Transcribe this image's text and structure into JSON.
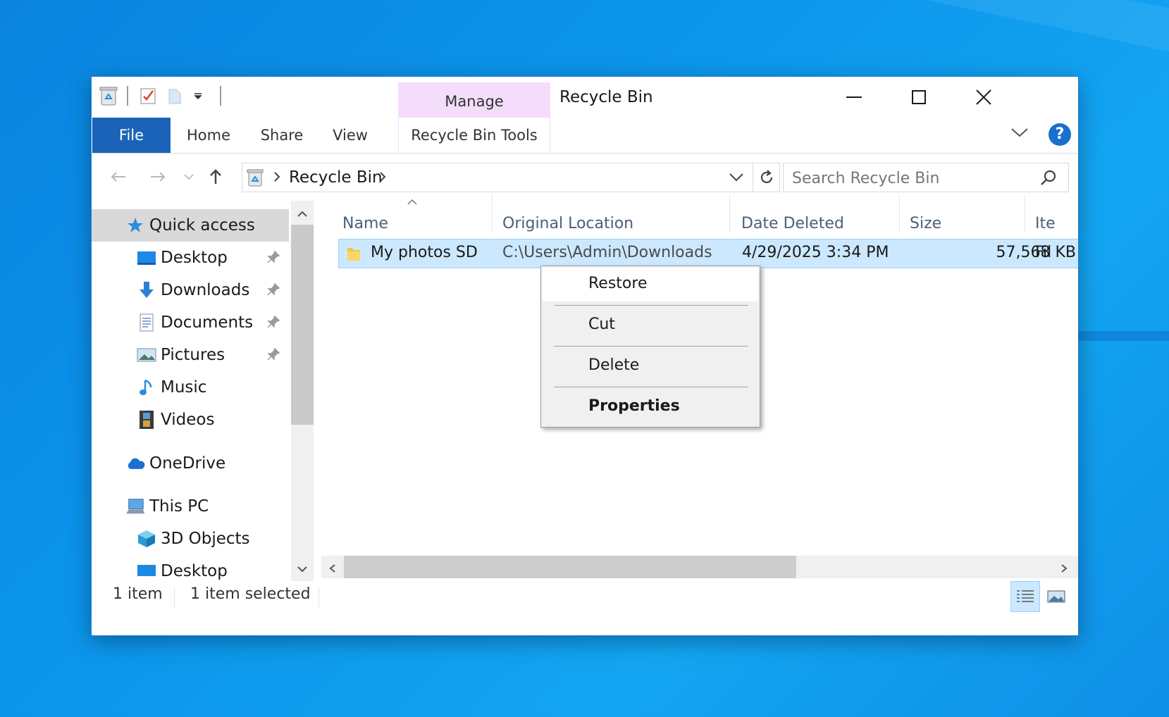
{
  "window": {
    "title": "Recycle Bin",
    "contextual_group": "Manage"
  },
  "ribbon": {
    "tabs": [
      {
        "label": "File"
      },
      {
        "label": "Home"
      },
      {
        "label": "Share"
      },
      {
        "label": "View"
      },
      {
        "label": "Recycle Bin Tools"
      }
    ]
  },
  "address": {
    "breadcrumb": [
      "Recycle Bin"
    ],
    "search_placeholder": "Search Recycle Bin"
  },
  "nav": {
    "items": [
      {
        "label": "Quick access",
        "icon": "star-icon"
      },
      {
        "label": "Desktop",
        "icon": "desktop-icon"
      },
      {
        "label": "Downloads",
        "icon": "download-arrow-icon"
      },
      {
        "label": "Documents",
        "icon": "documents-icon"
      },
      {
        "label": "Pictures",
        "icon": "pictures-icon"
      },
      {
        "label": "Music",
        "icon": "music-note-icon"
      },
      {
        "label": "Videos",
        "icon": "film-icon"
      },
      {
        "label": "OneDrive",
        "icon": "cloud-icon"
      },
      {
        "label": "This PC",
        "icon": "computer-icon"
      },
      {
        "label": "3D Objects",
        "icon": "cube-icon"
      },
      {
        "label": "Desktop",
        "icon": "desktop-icon"
      }
    ]
  },
  "columns": [
    {
      "label": "Name"
    },
    {
      "label": "Original Location"
    },
    {
      "label": "Date Deleted"
    },
    {
      "label": "Size"
    },
    {
      "label": "Ite"
    }
  ],
  "rows": [
    {
      "name": "My photos SD",
      "location": "C:\\Users\\Admin\\Downloads",
      "date": "4/29/2025 3:34 PM",
      "size": "57,568 KB",
      "type": "Fil"
    }
  ],
  "context_menu": {
    "items": [
      {
        "label": "Restore"
      },
      {
        "label": "Cut"
      },
      {
        "label": "Delete"
      },
      {
        "label": "Properties"
      }
    ]
  },
  "status": {
    "count": "1 item",
    "selected": "1 item selected"
  },
  "colors": {
    "accent": "#1a63b8",
    "selection": "#cce8ff",
    "manage_tab": "#f3ddfb"
  }
}
